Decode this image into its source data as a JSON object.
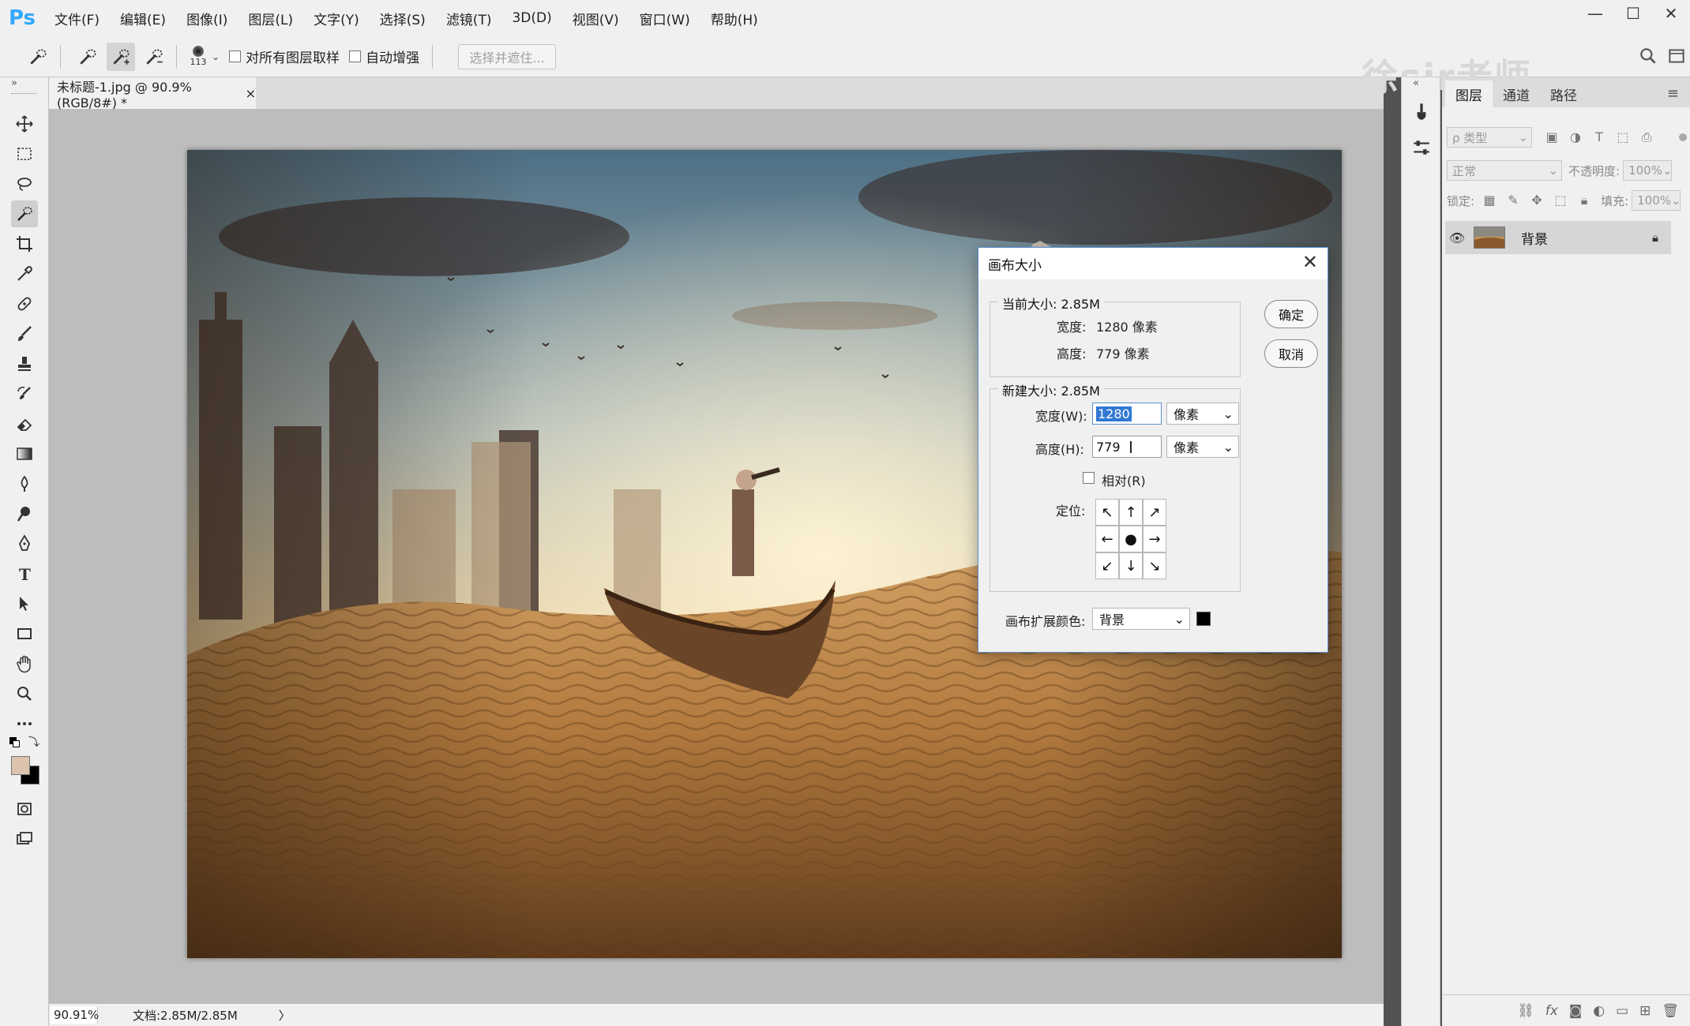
{
  "app": {
    "logo": "Ps",
    "menu": [
      "文件(F)",
      "编辑(E)",
      "图像(I)",
      "图层(L)",
      "文字(Y)",
      "选择(S)",
      "滤镜(T)",
      "3D(D)",
      "视图(V)",
      "窗口(W)",
      "帮助(H)"
    ],
    "window_controls": [
      "minimize-icon",
      "maximize-icon",
      "close-icon"
    ]
  },
  "options_bar": {
    "brush_size": "113",
    "sample_all_layers_label": "对所有图层取样",
    "auto_enhance_label": "自动增强",
    "select_and_mask_label": "选择并遮住...",
    "watermark": "徐sir老师"
  },
  "document": {
    "tab_title": "未标题-1.jpg @ 90.9%(RGB/8#) *",
    "tab_close": "×"
  },
  "status_bar": {
    "zoom": "90.91%",
    "doc_info": "文档:2.85M/2.85M",
    "arrow": "〉"
  },
  "layers_panel": {
    "tabs": [
      "图层",
      "通道",
      "路径"
    ],
    "filter_placeholder": "ρ 类型",
    "blend_mode": "正常",
    "opacity_label": "不透明度:",
    "opacity_value": "100%",
    "lock_label": "锁定:",
    "fill_label": "填充:",
    "fill_value": "100%",
    "layer_name": "背景"
  },
  "dialog": {
    "title": "画布大小",
    "close": "✕",
    "current_size_title": "当前大小: 2.85M",
    "current_width_label": "宽度:",
    "current_width_value": "1280 像素",
    "current_height_label": "高度:",
    "current_height_value": "779 像素",
    "new_size_title": "新建大小: 2.85M",
    "width_label": "宽度(W):",
    "width_value": "1280",
    "width_unit": "像素",
    "height_label": "高度(H):",
    "height_value": "779",
    "height_unit": "像素",
    "relative_label": "相对(R)",
    "anchor_label": "定位:",
    "anchor_arrows": [
      "↖",
      "↑",
      "↗",
      "←",
      "●",
      "→",
      "↙",
      "↓",
      "↘"
    ],
    "ext_color_label": "画布扩展颜色:",
    "ext_color_value": "背景",
    "ok_label": "确定",
    "cancel_label": "取消"
  }
}
